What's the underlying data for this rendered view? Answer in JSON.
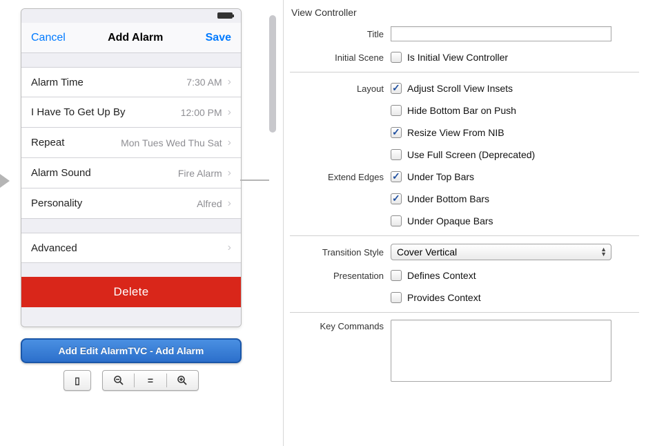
{
  "phone": {
    "nav": {
      "cancel": "Cancel",
      "title": "Add Alarm",
      "save": "Save"
    },
    "rows": {
      "alarm_time": {
        "label": "Alarm Time",
        "value": "7:30 AM"
      },
      "get_up": {
        "label": "I Have To Get Up By",
        "value": "12:00 PM"
      },
      "repeat": {
        "label": "Repeat",
        "value": "Mon Tues Wed Thu Sat"
      },
      "sound": {
        "label": "Alarm Sound",
        "value": "Fire Alarm"
      },
      "personality": {
        "label": "Personality",
        "value": "Alfred"
      },
      "advanced": {
        "label": "Advanced",
        "value": ""
      }
    },
    "delete": "Delete"
  },
  "selection_badge": "Add Edit AlarmTVC - Add Alarm",
  "inspector": {
    "header": "View Controller",
    "title_label": "Title",
    "title_value": "",
    "initial_scene_label": "Initial Scene",
    "initial_scene_cb": {
      "checked": false,
      "text": "Is Initial View Controller"
    },
    "layout_label": "Layout",
    "layout": [
      {
        "checked": true,
        "text": "Adjust Scroll View Insets"
      },
      {
        "checked": false,
        "text": "Hide Bottom Bar on Push"
      },
      {
        "checked": true,
        "text": "Resize View From NIB"
      },
      {
        "checked": false,
        "text": "Use Full Screen (Deprecated)"
      }
    ],
    "extend_label": "Extend Edges",
    "extend": [
      {
        "checked": true,
        "text": "Under Top Bars"
      },
      {
        "checked": true,
        "text": "Under Bottom Bars"
      },
      {
        "checked": false,
        "text": "Under Opaque Bars"
      }
    ],
    "transition_label": "Transition Style",
    "transition_value": "Cover Vertical",
    "presentation_label": "Presentation",
    "presentation": [
      {
        "checked": false,
        "text": "Defines Context"
      },
      {
        "checked": false,
        "text": "Provides Context"
      }
    ],
    "key_commands_label": "Key Commands"
  }
}
